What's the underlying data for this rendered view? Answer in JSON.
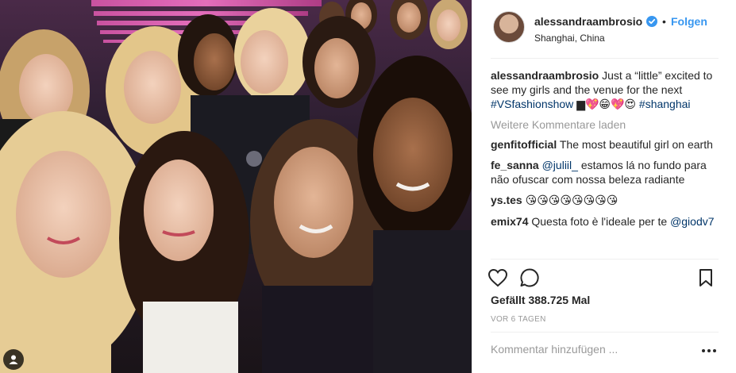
{
  "post": {
    "username": "alessandraambrosio",
    "separator": "•",
    "follow_label": "Folgen",
    "location": "Shanghai, China",
    "verified_icon": "verified-badge-icon",
    "accent_color": "#3897f0"
  },
  "caption": {
    "username": "alessandraambrosio",
    "text": "Just a “little” excited to see my girls and the venue for the next",
    "hashtag1": "#VSfashionshow",
    "emojis": "▆💖😁💖😍",
    "hashtag2": "#shanghai"
  },
  "load_more_label": "Weitere Kommentare laden",
  "comments": [
    {
      "username": "genfitofficial",
      "text": "The most beautiful girl on earth"
    },
    {
      "username": "fe_sanna",
      "mention": "@juliil_",
      "text": "estamos lá no fundo para não ofuscar com nossa beleza radiante"
    },
    {
      "username": "ys.tes",
      "text": "😘😘😘😘😘😘😘😘"
    },
    {
      "username": "emix74",
      "text": "Questa foto è l'ideale per te",
      "mention": "@giodv7"
    }
  ],
  "actions": {
    "like_icon": "heart-icon",
    "comment_icon": "comment-bubble-icon",
    "save_icon": "bookmark-icon"
  },
  "likes_label": "Gefällt 388.725 Mal",
  "timestamp": "VOR 6 TAGEN",
  "comment_placeholder": "Kommentar hinzufügen ...",
  "more_icon": "more-options-icon"
}
